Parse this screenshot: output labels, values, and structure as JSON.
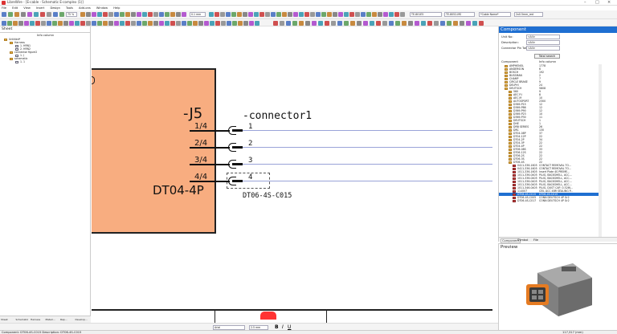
{
  "app": {
    "title": "LibreWire - [E-cable - Schematic E-complex (1)]",
    "menu": [
      "File",
      "Edit",
      "View",
      "Insert",
      "Design",
      "Tools",
      "Add-ons",
      "Window",
      "Help"
    ]
  },
  "toolbar": {
    "zoom": "75 %",
    "line_width": "0.1 mm",
    "font_size": "2.5 mm",
    "font": "Arial",
    "combo1": "TE-801E5",
    "combo2": "TE-8052-MS",
    "combo3": "*Cable Name*",
    "combo4": "2x0.5mm_red"
  },
  "sheet_panel": {
    "title": "Sheet",
    "col_info": "Info column",
    "items": [
      {
        "label": "Untitled*",
        "level": 0
      },
      {
        "label": "Harness",
        "level": 1
      },
      {
        "label": "1. HRN1",
        "level": 2
      },
      {
        "label": "2. HRN2",
        "level": 2
      },
      {
        "label": "connector figure2",
        "level": 1
      },
      {
        "label": "1. J",
        "level": 2
      },
      {
        "label": "schematic",
        "level": 1
      },
      {
        "label": "1. 1",
        "level": 2
      }
    ]
  },
  "schematic": {
    "ref": "-J5",
    "connector_label": "-connector1",
    "part": "DT04-4P",
    "mate_part": "DT06-4S-C015",
    "pins": [
      {
        "label": "1/4",
        "num": "1"
      },
      {
        "label": "2/4",
        "num": "2"
      },
      {
        "label": "3/4",
        "num": "3"
      },
      {
        "label": "4/4",
        "num": "4"
      }
    ]
  },
  "component_panel": {
    "title": "Component",
    "filters": [
      {
        "label": "Unit No:",
        "value": "<All>"
      },
      {
        "label": "Description:",
        "value": "<All>"
      },
      {
        "label": "Connector Pin Total:",
        "value": "<All>"
      }
    ],
    "search_label": "Total search",
    "col_component": "Component",
    "col_info": "Info column",
    "items": [
      {
        "label": "AMPHENOL",
        "info": "1778",
        "indent": 1
      },
      {
        "label": "ANDERSON",
        "info": "6",
        "indent": 1
      },
      {
        "label": "BOSCH",
        "info": "192",
        "indent": 1
      },
      {
        "label": "BUSSMAN",
        "info": "2",
        "indent": 1
      },
      {
        "label": "CHAMP",
        "info": "7",
        "indent": 1
      },
      {
        "label": "CIRCLE BRAKE",
        "info": "9",
        "indent": 1
      },
      {
        "label": "DELPHI",
        "info": "24",
        "indent": 1
      },
      {
        "label": "DEUTSCH",
        "info": "5808",
        "indent": 1
      },
      {
        "label": "560",
        "info": "9",
        "indent": 2
      },
      {
        "label": "AEC P.I",
        "info": "8",
        "indent": 2
      },
      {
        "label": "AEC M",
        "info": "10",
        "indent": 2
      },
      {
        "label": "AUTOSPORT",
        "info": "2300",
        "indent": 2
      },
      {
        "label": "D369-P15",
        "info": "12",
        "indent": 2
      },
      {
        "label": "D369-P86",
        "info": "12",
        "indent": 2
      },
      {
        "label": "D369-P90",
        "info": "12",
        "indent": 2
      },
      {
        "label": "D369-P23",
        "info": "10",
        "indent": 2
      },
      {
        "label": "D369-P30",
        "info": "11",
        "indent": 2
      },
      {
        "label": "DEUTSCH",
        "info": "1",
        "indent": 2
      },
      {
        "label": "DHE",
        "info": "1",
        "indent": 2
      },
      {
        "label": "DRB SERIES",
        "info": "26",
        "indent": 2
      },
      {
        "label": "DRC",
        "info": "130",
        "indent": 2
      },
      {
        "label": "DT04-08P",
        "info": "37",
        "indent": 2
      },
      {
        "label": "DT04-12P",
        "info": "22",
        "indent": 2
      },
      {
        "label": "DT04-2P",
        "info": "34",
        "indent": 2
      },
      {
        "label": "DT04-3P",
        "info": "22",
        "indent": 2
      },
      {
        "label": "DT04-4P",
        "info": "22",
        "indent": 2
      },
      {
        "label": "DT06-08S",
        "info": "33",
        "indent": 2
      },
      {
        "label": "DT06-12S",
        "info": "22",
        "indent": 2
      },
      {
        "label": "DT06-2S",
        "info": "22",
        "indent": 2
      },
      {
        "label": "DT06-3S",
        "info": "22",
        "indent": 2
      },
      {
        "label": "DT06-4S",
        "info": "22",
        "indent": 2
      },
      {
        "label": "0411-336-1605",
        "info": "CONTACT REMOVAL TO...",
        "indent": 3
      },
      {
        "label": "0411-336-1605",
        "info": "CONTACT REMOVAL TO...",
        "indent": 3
      },
      {
        "label": "1011-336-1605",
        "info": "Insert Plate 4S PREME...",
        "indent": 3
      },
      {
        "label": "1011-336-0405",
        "info": "PLUG, BACKSHELL, ACC...",
        "indent": 3
      },
      {
        "label": "1011-336-0405",
        "info": "PLUG, BACKSHELL, ACC...",
        "indent": 3
      },
      {
        "label": "1011-336-0405",
        "info": "PLUG, BACKSHELL, ACC...",
        "indent": 3
      },
      {
        "label": "1011-336-0405",
        "info": "PLUG, BACKSHELL, ACC...",
        "indent": 3
      },
      {
        "label": "1011-346-0405",
        "info": "PLUG, DUST CAP, 0.32IN...",
        "indent": 3
      },
      {
        "label": "114007",
        "info": "CEIL ACC 4BR SEALING P...",
        "indent": 3
      },
      {
        "label": "DT06-4S-C015",
        "info": "DT06-4S-C015",
        "indent": 3,
        "selected": true
      },
      {
        "label": "DT06-4S-C005",
        "info": "CONN DEUTSCH 4P Gr2",
        "indent": 3
      },
      {
        "label": "DT06-4S-C017",
        "info": "CONN DEUTSCH 4P Gr2",
        "indent": 3
      }
    ],
    "tabs": [
      "Component",
      "Symbol",
      "File"
    ]
  },
  "preview_panel": {
    "title": "Preview"
  },
  "bottom_tabs": [
    "Sheet",
    "Schematic",
    "Harness",
    "Materi...",
    "Rep...",
    "Develop..."
  ],
  "status": {
    "left": "Component: DT06-4S-C015 Description: DT06-4S-C015",
    "right": "117,317 (mm)"
  }
}
